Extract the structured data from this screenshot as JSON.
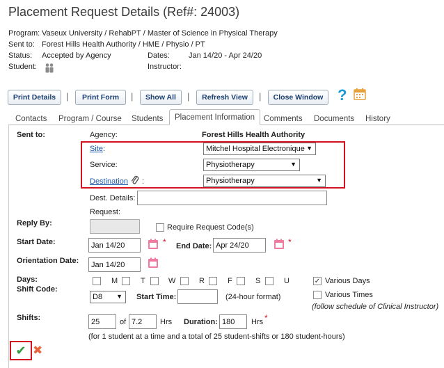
{
  "header": {
    "title": "Placement Request Details (Ref#: 24003)",
    "program_label": "Program:",
    "program_value": "Vaseux University / RehabPT / Master of Science in Physical Therapy",
    "sent_to_label": "Sent to:",
    "sent_to_value": "Forest Hills Health Authority / HME / Physio / PT",
    "status_label": "Status:",
    "status_value": "Accepted by Agency",
    "dates_label": "Dates:",
    "dates_value": "Jan 14/20 - Apr 24/20",
    "student_label": "Student:",
    "instructor_label": "Instructor:"
  },
  "toolbar": {
    "print_details": "Print Details",
    "print_form": "Print Form",
    "show_all": "Show All",
    "refresh_view": "Refresh View",
    "close_window": "Close Window",
    "separator": "|"
  },
  "tabs": [
    "Contacts",
    "Program / Course",
    "Students",
    "Placement Information",
    "Comments",
    "Documents",
    "History"
  ],
  "form": {
    "sent_to_label": "Sent to:",
    "agency_label": "Agency:",
    "agency_value": "Forest Hills Health Authority",
    "site_label": "Site",
    "site_colon": ":",
    "site_value": "Mitchel Hospital Electronique",
    "service_label": "Service:",
    "service_value": "Physiotherapy",
    "destination_label": "Destination",
    "destination_colon": ":",
    "destination_value": "Physiotherapy",
    "dest_details_label": "Dest. Details:",
    "dest_details_value": "",
    "request_label": "Request:",
    "reply_by_label": "Reply By:",
    "require_code_label": "Require Request Code(s)",
    "start_date_label": "Start Date:",
    "start_date_value": "Jan 14/20",
    "end_date_label": "End Date:",
    "end_date_value": "Apr 24/20",
    "orientation_label": "Orientation Date:",
    "orientation_value": "Jan 14/20",
    "days_label": "Days:",
    "days": [
      "M",
      "T",
      "W",
      "R",
      "F",
      "S",
      "U"
    ],
    "various_days_label": "Various Days",
    "shift_code_label": "Shift Code:",
    "shift_code_value": "D8",
    "start_time_label": "Start Time:",
    "start_time_value": "",
    "time_format_label": "(24-hour format)",
    "various_times_label": "Various Times",
    "follow_schedule": "(follow schedule of Clinical Instructor)",
    "shifts_label": "Shifts:",
    "shifts_value": "25",
    "of_label": "of",
    "hours_per_shift": "7.2",
    "hrs_label": "Hrs",
    "duration_label": "Duration:",
    "duration_value": "180",
    "hrs_label2": "Hrs",
    "summary": "(for 1 student at a time and a total of 25 student-shifts or 180 student-hours)",
    "required_mark": "*"
  },
  "icons": {
    "check": "✔",
    "cross": "✖",
    "help": "?",
    "arrow": "▼",
    "checkmark": "✓"
  },
  "colors": {
    "accent_red": "#d4121f",
    "link_blue": "#1a58a8",
    "confirm_green": "#2e9c3a",
    "cancel_orange": "#e8643c",
    "calendar_pink": "#f07aa0",
    "help_blue": "#1e9ad6",
    "calendar_orange": "#e6a23c"
  }
}
